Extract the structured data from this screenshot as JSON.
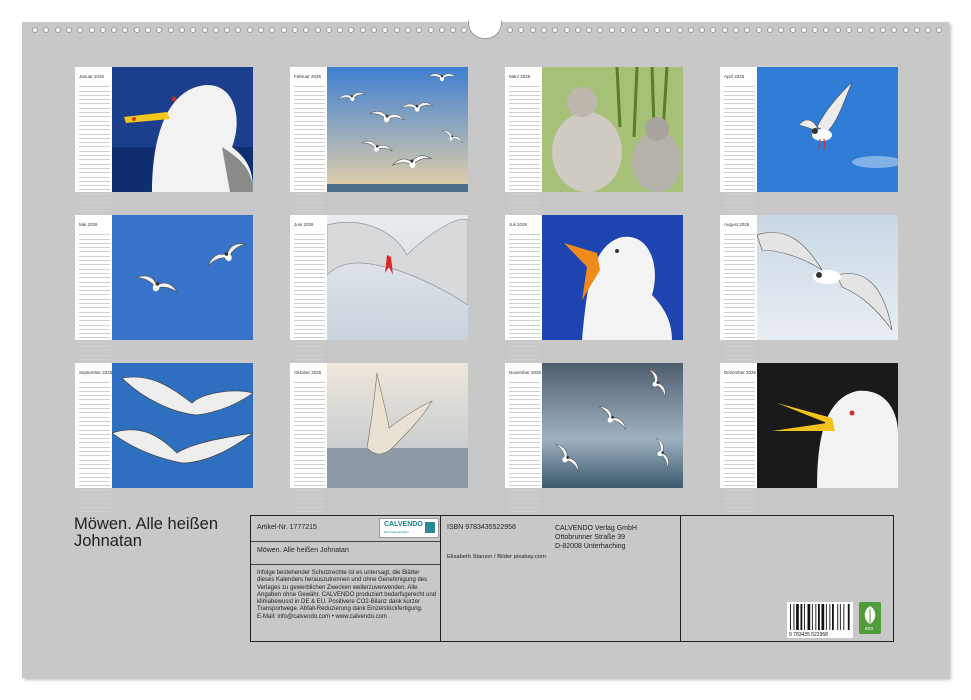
{
  "months": [
    {
      "name": "Januar 2026",
      "photo": "gull-head-yellow-beak"
    },
    {
      "name": "Februar 2026",
      "photo": "gulls-flock-sky"
    },
    {
      "name": "März 2026",
      "photo": "gull-chicks-grass"
    },
    {
      "name": "April 2026",
      "photo": "gull-flying-blue-sky"
    },
    {
      "name": "Mai 2026",
      "photo": "two-gulls-blue-sky"
    },
    {
      "name": "Juni 2026",
      "photo": "gull-wings-closeup"
    },
    {
      "name": "Juli 2026",
      "photo": "gull-screaming"
    },
    {
      "name": "August 2026",
      "photo": "gull-gliding"
    },
    {
      "name": "September 2026",
      "photo": "two-gulls-wings-spread"
    },
    {
      "name": "Oktober 2026",
      "photo": "gull-over-sea"
    },
    {
      "name": "November 2026",
      "photo": "gulls-stormy-sky"
    },
    {
      "name": "Dezember 2026",
      "photo": "gull-open-beak-dark"
    }
  ],
  "title": "Möwen. Alle heißen Johnatan",
  "info": {
    "article": "Artikel-Nr. 1777215",
    "subtitle": "Möwen. Alle heißen Johnatan",
    "legal": "Infolge bestehender Schutzrechte ist es untersagt, die Blätter dieses Kalenders herauszutrennen und ohne Genehmigung des Verlages zu gewerblichen Zwecken weiterzuverwenden. Alle Angaben ohne Gewähr. CALVENDO produziert bedarfsgerecht und klimabewusst in DE & EU. Positivere CO2-Bilanz dank kurzer Transportwege. Abfall-Reduzierung dank Einzelstückfertigung.",
    "contact": "E-Mail: info@calvendo.com • www.calvendo.com",
    "isbn": "ISBN 9783435522958",
    "publisher_name": "CALVENDO Verlag GmbH",
    "publisher_street": "Ottobrunner Straße 39",
    "publisher_city": "D-82008 Unterhaching",
    "credits": "Elisabeth Stanzer / Bilder pixabay.com",
    "logo_text": "CALVENDO",
    "logo_sub": "Das Kalenderlabel",
    "barcode_text": "9 783435 522958",
    "eco_label": "eco"
  }
}
